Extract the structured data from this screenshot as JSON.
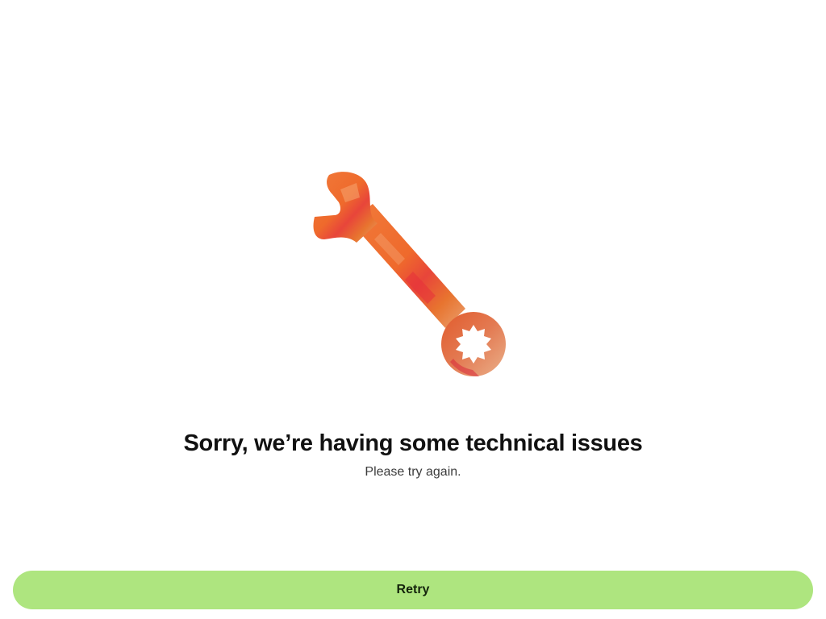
{
  "error": {
    "illustration_icon": "wrench-icon",
    "title": "Sorry, we’re having some technical issues",
    "subtitle": "Please try again."
  },
  "actions": {
    "retry_label": "Retry"
  },
  "colors": {
    "background": "#ffffff",
    "button": "#aee57f",
    "wrench_orange": "#ef6a2c",
    "wrench_red": "#e8333a"
  }
}
